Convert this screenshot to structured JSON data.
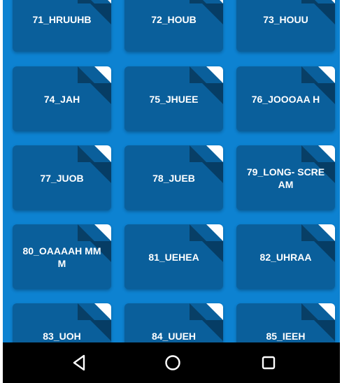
{
  "colors": {
    "background": "#0d82d1",
    "tile": "#0a5f9b",
    "tile_text": "#ffffff",
    "navbar": "#000000"
  },
  "tiles": [
    {
      "label": "71_HRUUHB"
    },
    {
      "label": "72_HOUB"
    },
    {
      "label": "73_HOUU"
    },
    {
      "label": "74_JAH"
    },
    {
      "label": "75_JHUEE"
    },
    {
      "label": "76_JOOOAA H"
    },
    {
      "label": "77_JUOB"
    },
    {
      "label": "78_JUEB"
    },
    {
      "label": "79_LONG- SCREAM"
    },
    {
      "label": "80_OAAAAH MMM"
    },
    {
      "label": "81_UEHEA"
    },
    {
      "label": "82_UHRAA"
    },
    {
      "label": "83_UOH"
    },
    {
      "label": "84_UUEH"
    },
    {
      "label": "85_IEEH"
    }
  ],
  "navbar": {
    "back_icon": "back-triangle-icon",
    "home_icon": "home-circle-icon",
    "recents_icon": "recents-square-icon"
  }
}
